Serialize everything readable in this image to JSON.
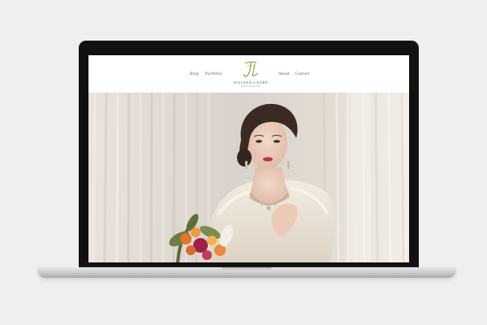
{
  "nav": {
    "blog": "Blog",
    "portfolio": "Portfolio",
    "about": "About",
    "contact": "Contact"
  },
  "logo": {
    "monogram": "JL",
    "name": "JULIANA LAURY",
    "tagline": "PHOTOGRAPHY"
  },
  "colors": {
    "logo_accent": "#8a9a3a",
    "bezel": "#111111",
    "page_background": "#efefef"
  },
  "hero": {
    "image_icon": "bride-portrait-photo"
  }
}
